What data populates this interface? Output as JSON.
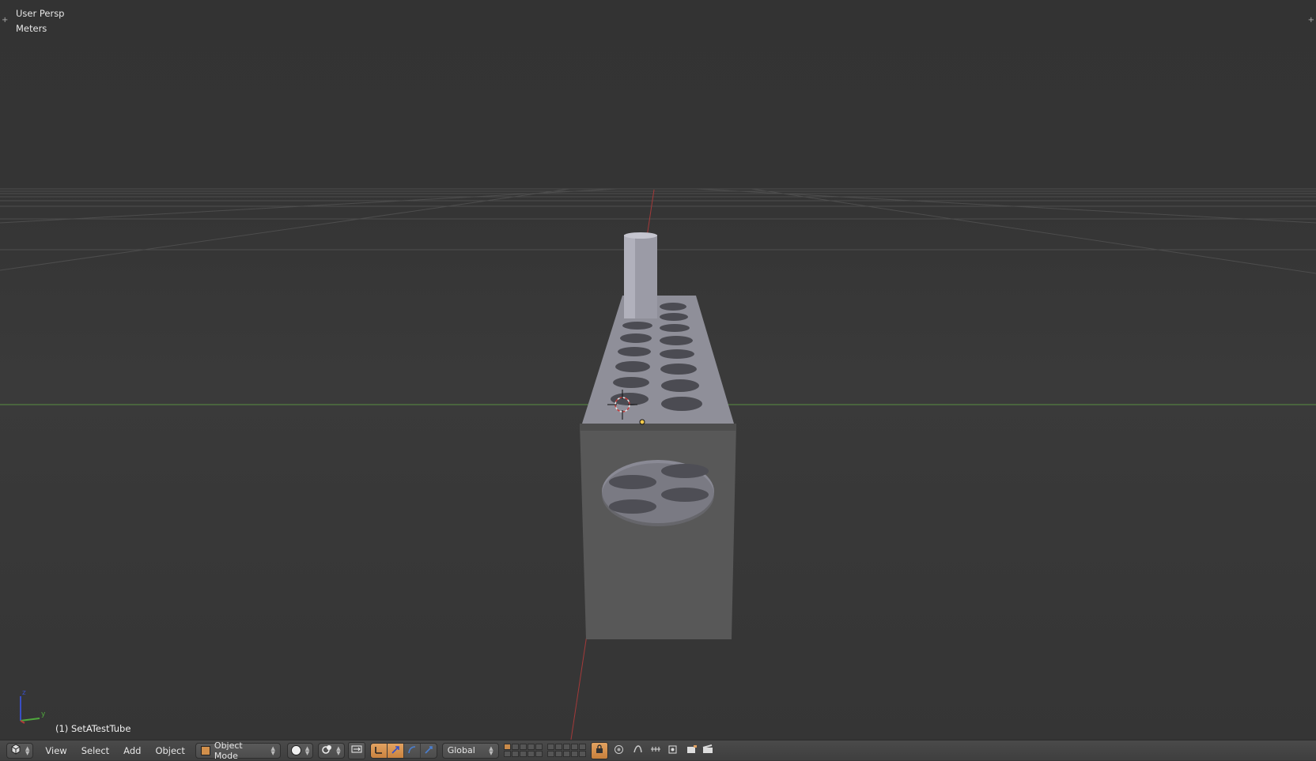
{
  "viewport": {
    "view_name": "User Persp",
    "units": "Meters",
    "active_object": "(1) SetATestTube",
    "axis_labels": {
      "z": "z",
      "y": "y"
    }
  },
  "header": {
    "editor_type_icon": "3d-view-icon",
    "menus": [
      "View",
      "Select",
      "Add",
      "Object"
    ],
    "mode": "Object Mode",
    "transform_orientation": "Global"
  },
  "colors": {
    "viewport_bg": "#393939",
    "header_bg": "#454545",
    "accent": "#d18f4b",
    "x_axis": "#b03a3a",
    "y_axis": "#6aa84f",
    "mesh": "#8d8d99"
  }
}
